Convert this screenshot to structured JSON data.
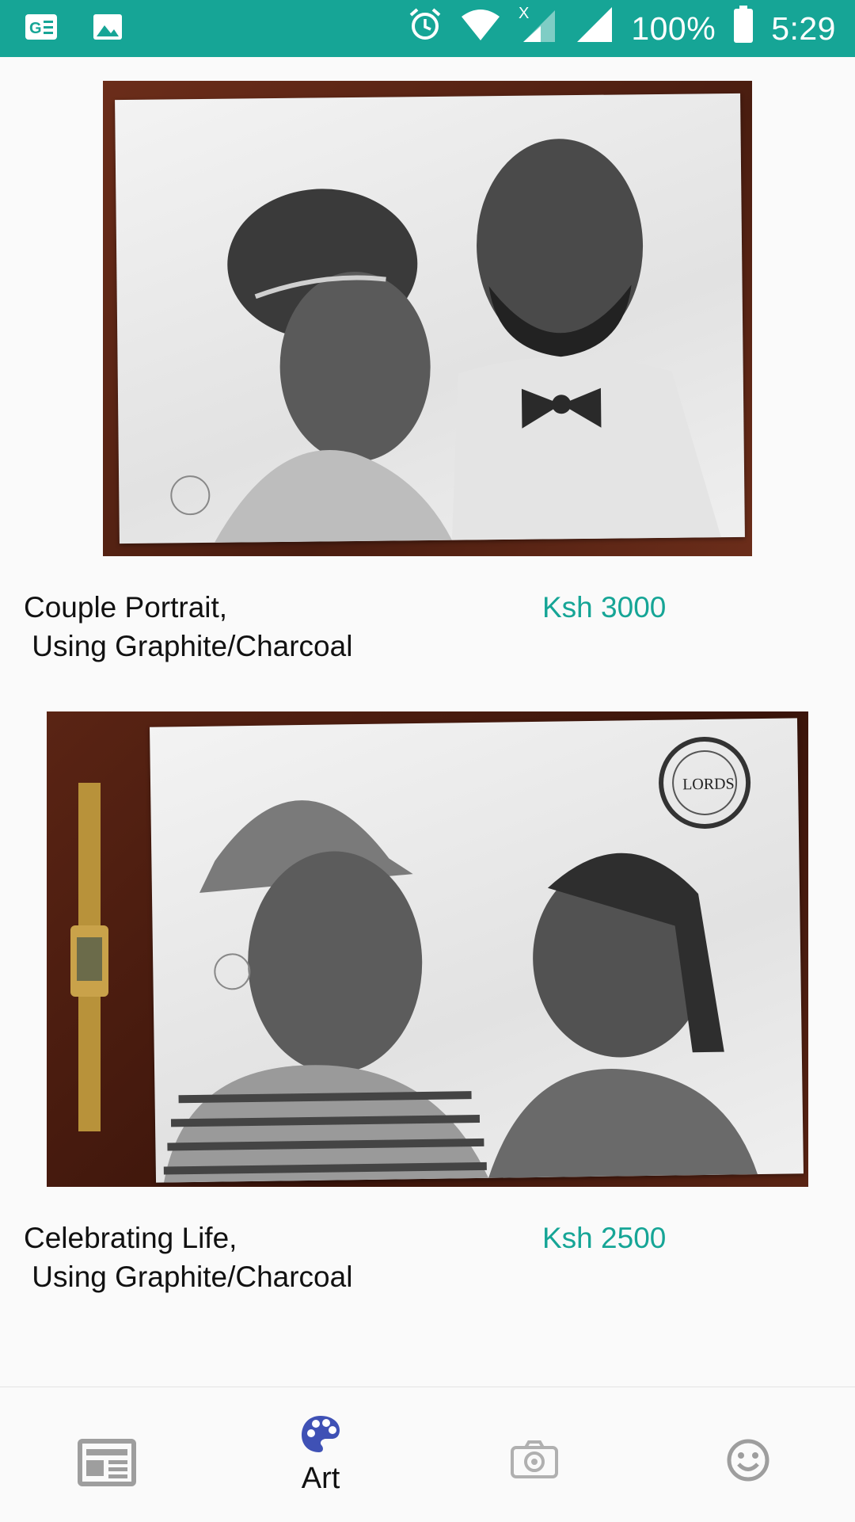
{
  "status_bar": {
    "battery": "100%",
    "time": "5:29",
    "icons": [
      "news-app-icon",
      "gallery-icon",
      "alarm-icon",
      "wifi-icon",
      "no-data-signal-icon",
      "signal-icon",
      "battery-icon"
    ]
  },
  "artworks": [
    {
      "title": "Couple Portrait,\n Using Graphite/Charcoal",
      "price": "Ksh 3000",
      "image_desc": "graphite-portrait-couple"
    },
    {
      "title": "Celebrating Life,\n Using Graphite/Charcoal",
      "price": "Ksh 2500",
      "image_desc": "graphite-portrait-celebrating-life"
    }
  ],
  "bottom_nav": {
    "items": [
      {
        "icon": "newspaper-icon",
        "label": ""
      },
      {
        "icon": "palette-icon",
        "label": "Art",
        "active": true
      },
      {
        "icon": "camera-icon",
        "label": ""
      },
      {
        "icon": "smiley-icon",
        "label": ""
      }
    ]
  },
  "colors": {
    "accent": "#16a596",
    "active_icon": "#3f51b5",
    "inactive_icon": "#9e9e9e"
  }
}
